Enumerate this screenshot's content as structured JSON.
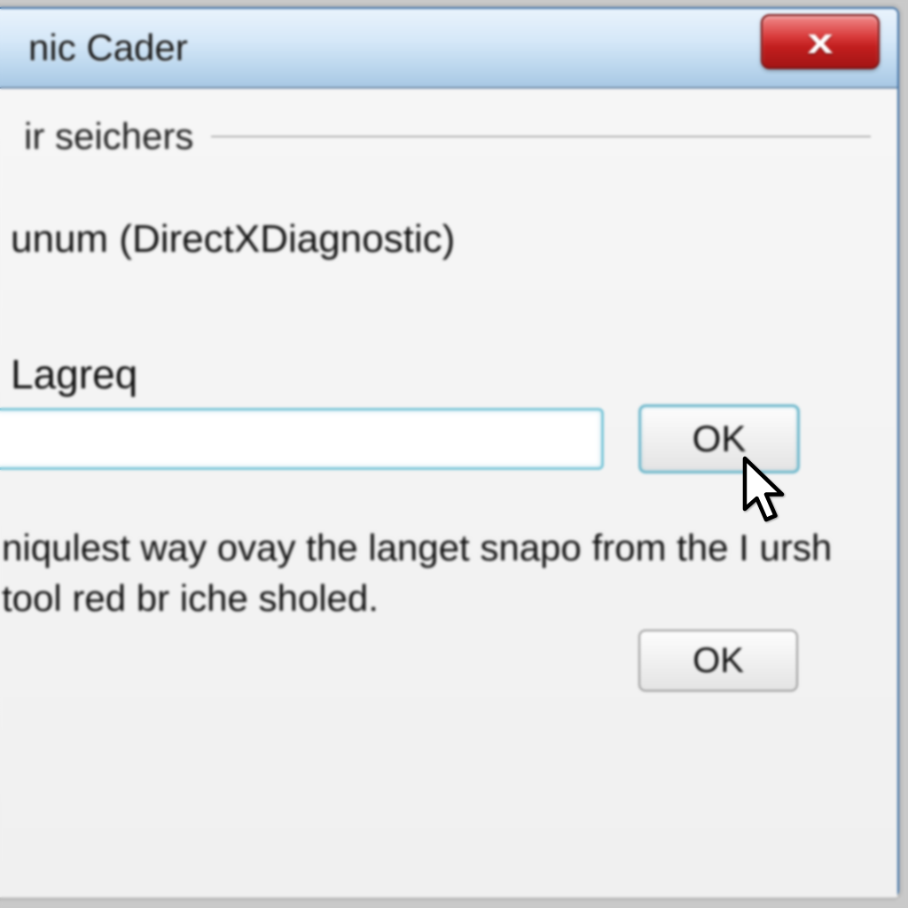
{
  "window": {
    "title": "nic Cader"
  },
  "group": {
    "label": "ir seichers"
  },
  "diag": {
    "text": "unum (DirectXDiagnostic)"
  },
  "field": {
    "label": "Lagreq",
    "value": ""
  },
  "buttons": {
    "ok1": "OK",
    "ok2": "OK"
  },
  "description": {
    "text": "niqulest way ovay the langet snapo from the I ursh tool red br iche sholed."
  }
}
